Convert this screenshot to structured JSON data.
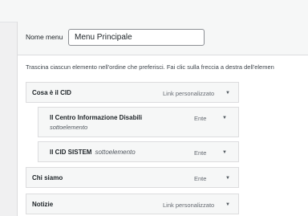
{
  "menu_name": {
    "label": "Nome menu",
    "value": "Menu Principale"
  },
  "instructions": "Trascina ciascun elemento nell'ordine che preferisci. Fai clic sulla freccia a destra dell'elemen",
  "menu_items": [
    {
      "title": "Cosa è il CID",
      "subtitle": "",
      "type": "Link personalizzato",
      "toggle": "▼"
    },
    {
      "title": "Il Centro Informazione Disabili",
      "subtitle": "sottoelemento",
      "type": "Ente",
      "toggle": "▼"
    },
    {
      "title": "Il CID SISTEM",
      "subtitle": "sottoelemento",
      "type": "Ente",
      "toggle": "▼"
    },
    {
      "title": "Chi siamo",
      "subtitle": "",
      "type": "Ente",
      "toggle": "▼"
    },
    {
      "title": "Notizie",
      "subtitle": "",
      "type": "Link personalizzato",
      "toggle": "▼"
    }
  ]
}
